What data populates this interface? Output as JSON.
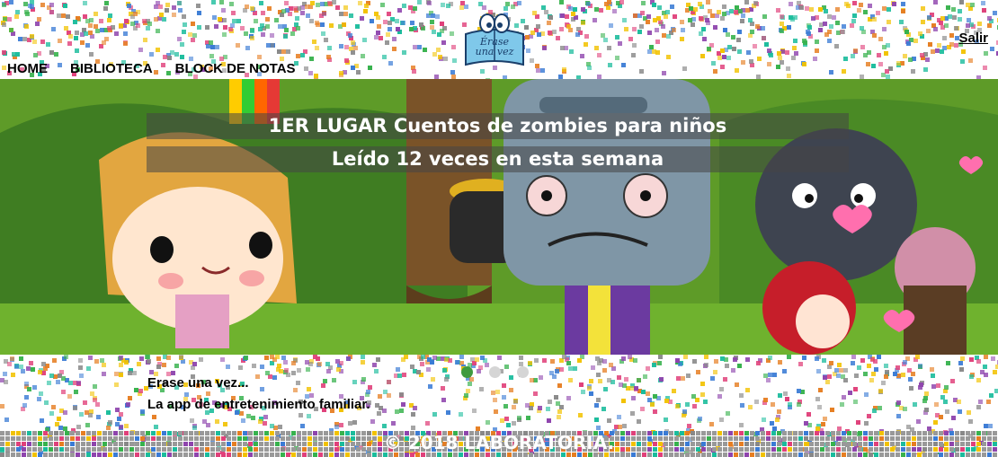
{
  "nav": {
    "home": "HOME",
    "library": "BIBLIOTECA",
    "notes": "BLOCK DE NOTAS",
    "logout": "Salir"
  },
  "logo": {
    "line1": "Érase",
    "line2": "una vez",
    "icon": "book-with-eyes-logo"
  },
  "carousel": {
    "caption_title": "1ER LUGAR Cuentos de zombies para niños",
    "caption_reads": "Leído 12 veces en esta semana",
    "slides": 3,
    "active_slide": 1
  },
  "tagline": {
    "line1": "Erase una vez...",
    "line2": "La app de entretenimiento familiar."
  },
  "footer": {
    "copyright": "© 2018 LABORATORIA."
  },
  "colors": {
    "accent_green": "#3f9a3f",
    "confetti": [
      "#e0407a",
      "#f2c200",
      "#3a7bd5",
      "#37b24d",
      "#8e44ad",
      "#e67e22",
      "#1abc9c",
      "#888888"
    ]
  }
}
